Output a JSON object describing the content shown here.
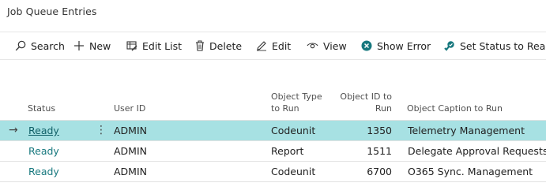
{
  "page": {
    "title": "Job Queue Entries"
  },
  "toolbar": {
    "search_label": "Search",
    "new_label": "New",
    "edit_list_label": "Edit List",
    "delete_label": "Delete",
    "edit_label": "Edit",
    "view_label": "View",
    "show_error_label": "Show Error",
    "set_status_label": "Set Status to Ready"
  },
  "table": {
    "columns": {
      "status": "Status",
      "user_id": "User ID",
      "object_type_1": "Object Type",
      "object_type_2": "to Run",
      "object_id_1": "Object ID to",
      "object_id_2": "Run",
      "object_caption": "Object Caption to Run"
    },
    "rows": [
      {
        "status": "Ready",
        "user_id": "ADMIN",
        "object_type": "Codeunit",
        "object_id": "1350",
        "caption": "Telemetry Management",
        "selected": true
      },
      {
        "status": "Ready",
        "user_id": "ADMIN",
        "object_type": "Report",
        "object_id": "1511",
        "caption": "Delegate Approval Requests",
        "selected": false
      },
      {
        "status": "Ready",
        "user_id": "ADMIN",
        "object_type": "Codeunit",
        "object_id": "6700",
        "caption": "O365 Sync. Management",
        "selected": false
      }
    ]
  },
  "colors": {
    "accent": "#17787e",
    "selected_row": "#a7e1e3"
  }
}
